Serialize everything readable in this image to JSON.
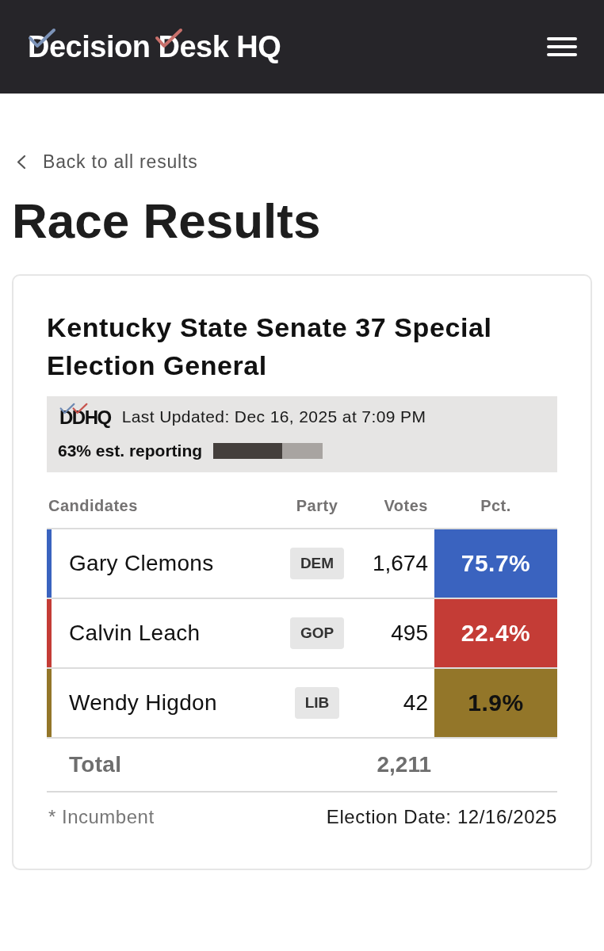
{
  "header": {
    "logo": "Decision Desk HQ"
  },
  "back_link": {
    "label": "Back to all results"
  },
  "page_title": "Race Results",
  "race": {
    "title": "Kentucky State Senate 37 Special Election General",
    "status": {
      "logo": "DDHQ",
      "last_updated": "Last Updated: Dec 16, 2025 at 7:09 PM",
      "reporting": "63% est. reporting",
      "level": 0.63
    },
    "table": {
      "columns": [
        "Candidates",
        "Party",
        "Votes",
        "Pct."
      ],
      "rows": [
        {
          "name": "Gary Clemons",
          "party": "DEM",
          "votes": "1,674",
          "pct": "75.7%",
          "color": "#3a63bf"
        },
        {
          "name": "Calvin Leach",
          "party": "GOP",
          "votes": "495",
          "pct": "22.4%",
          "color": "#c43c36"
        },
        {
          "name": "Wendy Higdon",
          "party": "LIB",
          "votes": "42",
          "pct": "1.9%",
          "color": "#937629"
        }
      ],
      "total": {
        "label": "Total",
        "votes": "2,211"
      }
    },
    "footnote": "* Incumbent",
    "election_date": "Election Date: 12/16/2025"
  }
}
